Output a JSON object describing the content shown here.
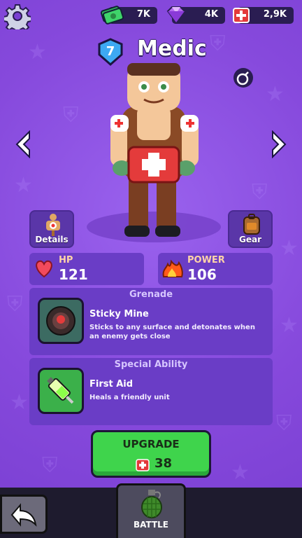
{
  "resources": {
    "cash": "7K",
    "gems": "4K",
    "medkits": "2,9K"
  },
  "unit": {
    "level": "7",
    "name": "Medic"
  },
  "buttons": {
    "details": "Details",
    "gear": "Gear",
    "upgrade": "UPGRADE",
    "upgrade_cost": "38",
    "battle": "BATTLE"
  },
  "stats": {
    "hp_label": "HP",
    "hp_value": "121",
    "power_label": "POWER",
    "power_value": "106"
  },
  "grenade": {
    "header": "Grenade",
    "name": "Sticky Mine",
    "description": "Sticks to any surface and detonates when an enemy gets close"
  },
  "ability": {
    "header": "Special Ability",
    "name": "First Aid",
    "description": "Heals a friendly unit"
  },
  "colors": {
    "background": "#8a4fe0",
    "panel": "#6a3dc6",
    "upgrade_green": "#3fd44c",
    "bottom_bar": "#1e1b2e"
  },
  "icons": {
    "settings": "gear-icon",
    "cash": "cash-icon",
    "gems": "gem-icon",
    "medkits": "medkit-icon",
    "hp": "heart-icon",
    "power": "flame-icon",
    "back": "back-arrow-icon",
    "battle": "grenade-icon"
  }
}
